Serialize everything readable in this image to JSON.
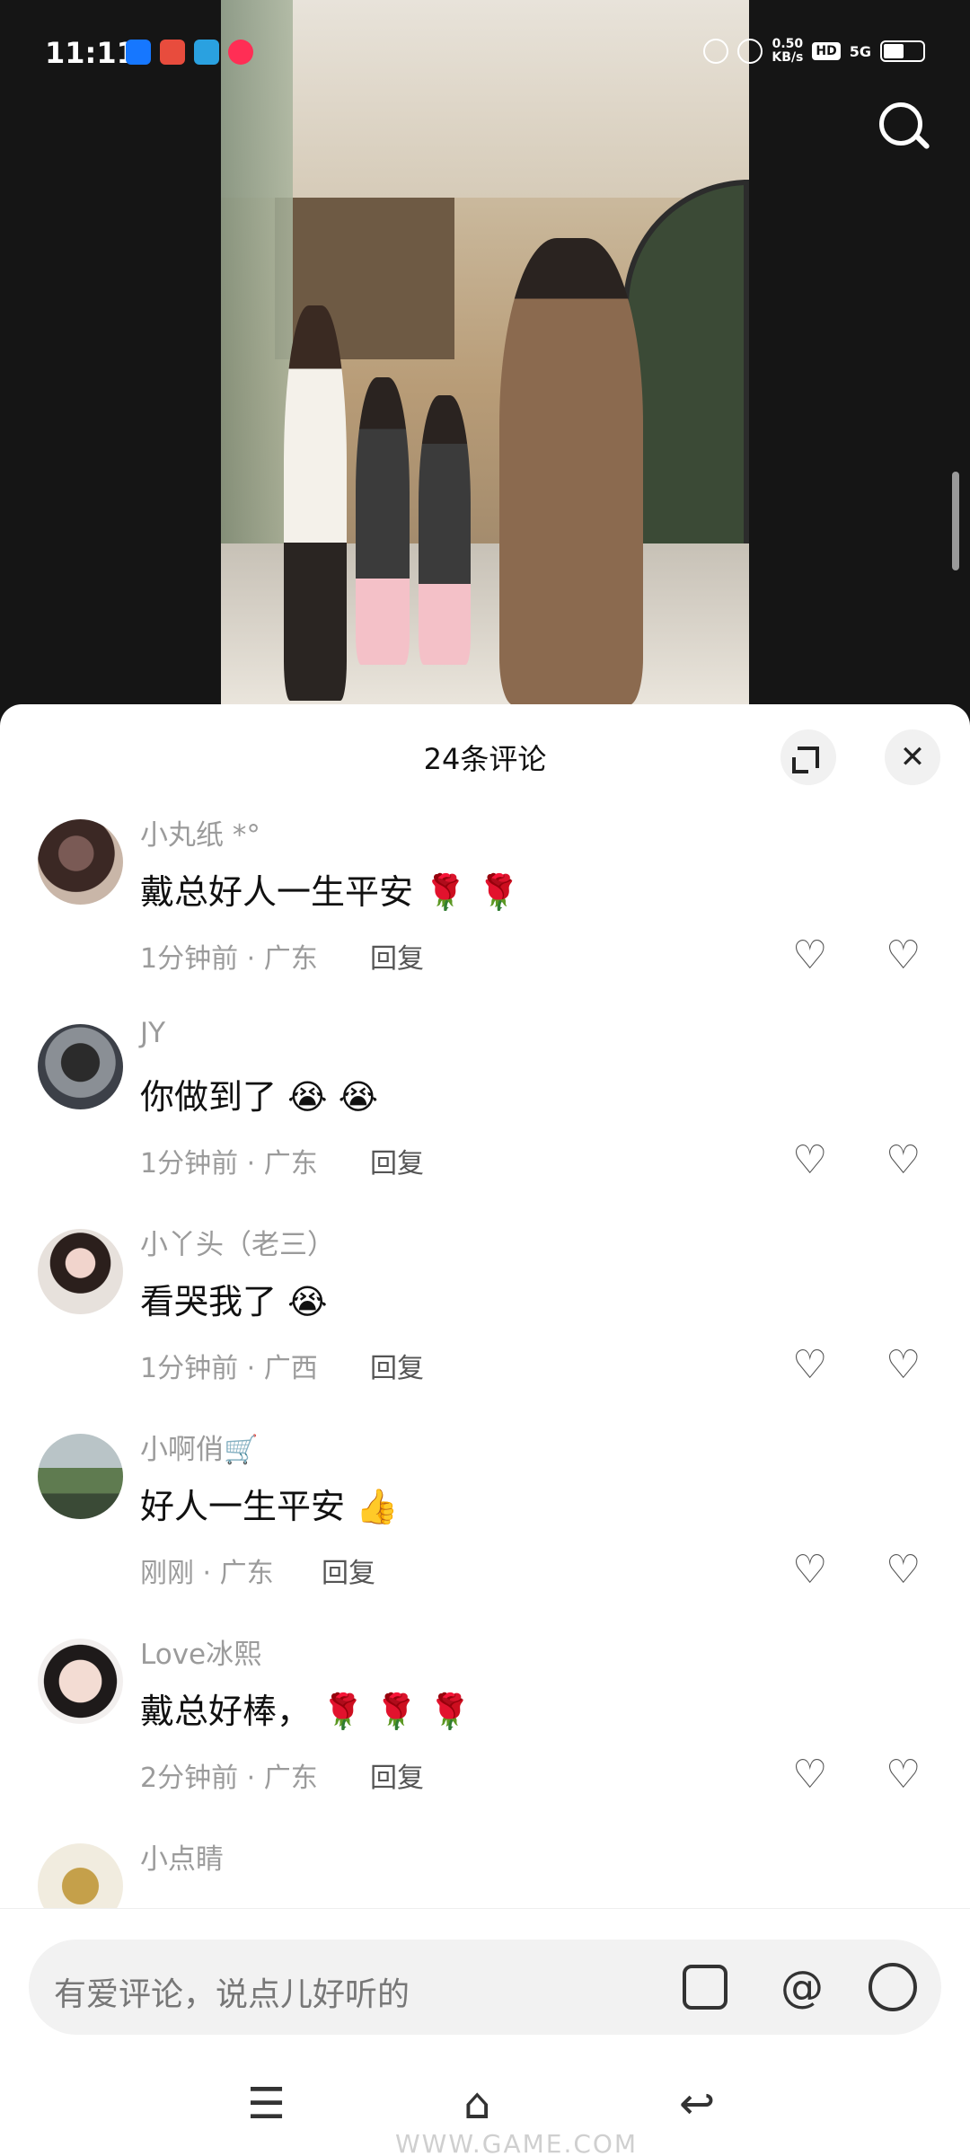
{
  "status_bar": {
    "time": "11:11",
    "net_speed": "0.50",
    "net_speed_unit": "KB/s",
    "hd_badge": "HD",
    "network": "5G"
  },
  "sheet": {
    "title": "24条评论"
  },
  "comments": [
    {
      "user": "小丸纸 *°",
      "text": "戴总好人一生平安",
      "emoji": [
        "🌹",
        "🌹"
      ],
      "time": "1分钟前",
      "location": "广东",
      "reply": "回复"
    },
    {
      "user": "JY",
      "text": "你做到了",
      "emoji": [
        "😭",
        "😭"
      ],
      "time": "1分钟前",
      "location": "广东",
      "reply": "回复"
    },
    {
      "user": "小丫头（老三）",
      "text": "看哭我了",
      "emoji": [
        "😭"
      ],
      "time": "1分钟前",
      "location": "广西",
      "reply": "回复"
    },
    {
      "user": "小啊俏🛒",
      "text": "好人一生平安",
      "emoji": [
        "👍"
      ],
      "time": "刚刚",
      "location": "广东",
      "reply": "回复"
    },
    {
      "user": "Love冰熙",
      "text": "戴总好棒，",
      "emoji": [
        "🌹",
        "🌹",
        "🌹"
      ],
      "time": "2分钟前",
      "location": "广东",
      "reply": "回复"
    },
    {
      "user": "小点睛",
      "text": "",
      "emoji": [],
      "time": "",
      "location": "",
      "reply": ""
    }
  ],
  "input": {
    "placeholder": "有爱评论，说点儿好听的",
    "at": "@"
  },
  "meta_separator": " · ",
  "watermark": "WWW.GAME.COM"
}
